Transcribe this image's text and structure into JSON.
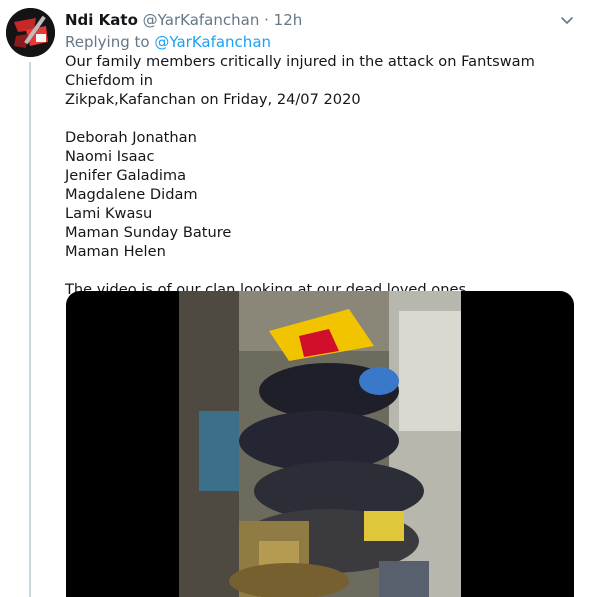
{
  "tweet": {
    "author_name": "Ndi Kato",
    "author_handle": "@YarKafanchan",
    "separator": "·",
    "time": "12h",
    "replying_prefix": "Replying to",
    "replying_to": "@YarKafanchan",
    "text_intro_line1": "Our family members critically injured in the attack on Fantswam Chiefdom in",
    "text_intro_line2": "Zikpak,Kafanchan on Friday, 24/07 2020",
    "names": [
      "Deborah Jonathan",
      "Naomi Isaac",
      "Jenifer Galadima",
      "Magdalene Didam",
      "Lami Kwasu",
      "Maman Sunday Bature",
      "Maman Helen"
    ],
    "text_outro": "The video is of our clan looking at our dead loved ones..."
  },
  "icons": {
    "more": "chevron-down-icon",
    "avatar": "avatar-image"
  },
  "colors": {
    "link": "#1da1f2",
    "secondary": "#657786",
    "thread_line": "#ccd6dd",
    "text": "#14171a"
  }
}
